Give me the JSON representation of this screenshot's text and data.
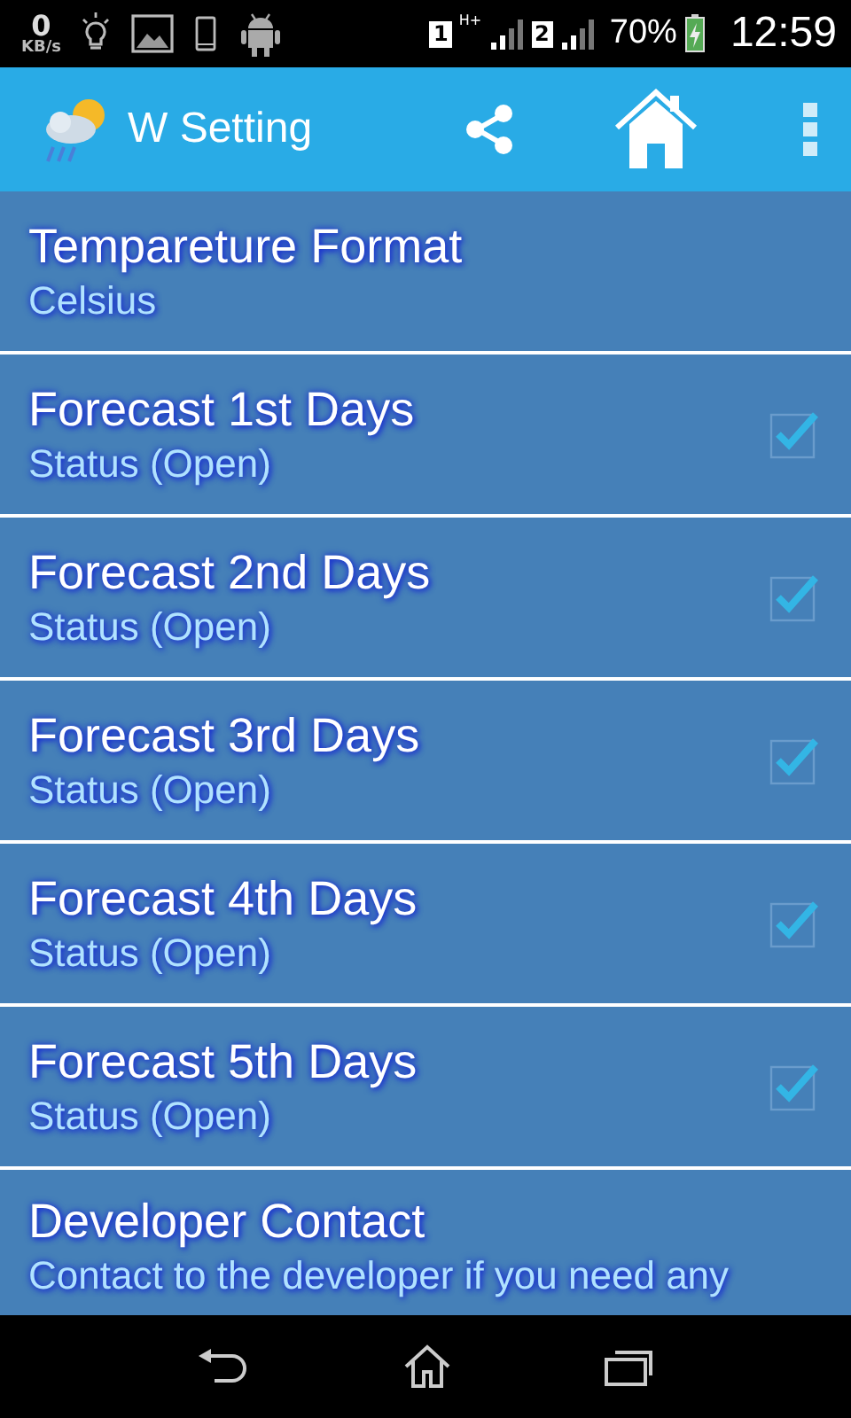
{
  "status_bar": {
    "speed": "0",
    "speed_unit": "KB/s",
    "sim1": "1",
    "network": "H+",
    "sim2": "2",
    "battery": "70%",
    "time": "12:59"
  },
  "app_bar": {
    "title": "W Setting"
  },
  "settings": [
    {
      "kind": "text",
      "title": "Tempareture Format",
      "summary": "Celsius"
    },
    {
      "kind": "checkbox",
      "title": "Forecast 1st Days",
      "summary": "Status (Open)",
      "checked": true
    },
    {
      "kind": "checkbox",
      "title": "Forecast 2nd Days",
      "summary": "Status (Open)",
      "checked": true
    },
    {
      "kind": "checkbox",
      "title": "Forecast 3rd Days",
      "summary": "Status (Open)",
      "checked": true
    },
    {
      "kind": "checkbox",
      "title": "Forecast 4th Days",
      "summary": "Status (Open)",
      "checked": true
    },
    {
      "kind": "checkbox",
      "title": "Forecast 5th Days",
      "summary": "Status (Open)",
      "checked": true
    },
    {
      "kind": "text",
      "title": "Developer Contact",
      "summary": "Contact to the developer if you need any"
    }
  ]
}
